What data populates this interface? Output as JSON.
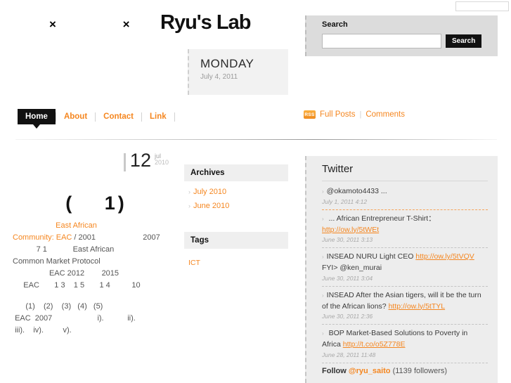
{
  "site": {
    "title": "Ryu's Lab",
    "header_glyphs": "× ×"
  },
  "top_input": {
    "value": "",
    "placeholder": ""
  },
  "date_ticket": {
    "day_of_week": "MONDAY",
    "full_date": "July 4, 2011"
  },
  "search": {
    "label": "Search",
    "input_value": "",
    "placeholder": "",
    "button_label": "Search"
  },
  "nav": {
    "items": [
      {
        "label": "Home",
        "active": true
      },
      {
        "label": "About",
        "active": false
      },
      {
        "label": "Contact",
        "active": false
      },
      {
        "label": "Link",
        "active": false
      }
    ]
  },
  "feeds": {
    "rss_badge": "RSS",
    "full_posts": "Full Posts",
    "separator": "|",
    "comments": "Comments"
  },
  "article": {
    "day": "12",
    "month": "jul",
    "year": "2010",
    "title": "(　 1)",
    "lines": [
      {
        "segments": [
          {
            "text": "                    ",
            "accent": false
          },
          {
            "text": "East African",
            "accent": true
          }
        ]
      },
      {
        "segments": [
          {
            "text": "Community: EAC",
            "accent": true
          },
          {
            "text": " / 2001                      2007",
            "accent": false
          }
        ]
      },
      {
        "segments": [
          {
            "text": "           7 1            East African",
            "accent": false
          }
        ]
      },
      {
        "segments": [
          {
            "text": "Common Market Protocol",
            "accent": false
          }
        ]
      },
      {
        "segments": [
          {
            "text": "                 EAC 2012        2015",
            "accent": false
          }
        ]
      },
      {
        "segments": [
          {
            "text": "     EAC       1 3    1 5       1 4          10",
            "accent": false
          }
        ]
      },
      {
        "gap": true
      },
      {
        "segments": [
          {
            "text": "      (1)    (2)    (3)   (4)   (5)",
            "accent": false
          }
        ]
      },
      {
        "segments": [
          {
            "text": " EAC  2007                     i).           ii).",
            "accent": false
          }
        ]
      },
      {
        "segments": [
          {
            "text": " iii).    iv).         v).",
            "accent": false
          }
        ]
      }
    ]
  },
  "archives": {
    "heading": "Archives",
    "items": [
      "July 2010",
      "June 2010"
    ]
  },
  "tags": {
    "heading": "Tags",
    "items": [
      "ICT"
    ]
  },
  "twitter": {
    "heading": "Twitter",
    "tweets": [
      {
        "text": "@okamoto4433                ...",
        "link": "",
        "time": "July 1, 2011 4:12",
        "sep_accent": true
      },
      {
        "text": "              ... African Entrepreneur T-Shirt：",
        "link": "http://ow.ly/5tWEt",
        "time": "June 30, 2011 3:13",
        "sep_accent": false
      },
      {
        "text": "INSEAD            NURU Light       CEO",
        "link": "http://ow.ly/5tVQV",
        "link_suffix": " FYI> @ken_murai",
        "time": "June 30, 2011 3:04",
        "sep_accent": false
      },
      {
        "text": "INSEAD                    After the Asian tigers, will it be the turn of the African lions?",
        "link": "http://ow.ly/5tTYL",
        "time": "June 30, 2011 2:36",
        "sep_accent": false
      },
      {
        "text": "        BOP              Market-Based Solutions to Poverty in Africa",
        "link": "http://t.co/o5Z778E",
        "time": "June 28, 2011 11:48",
        "sep_accent": false
      }
    ],
    "follow_prefix": "Follow ",
    "follow_handle": "@ryu_saito",
    "follow_count": " (1139 followers)"
  },
  "colors": {
    "accent": "#f5861f",
    "panel_bg": "#ededed",
    "search_bg": "#dcdcdc",
    "ticket_bg": "#f2f2f2",
    "dark": "#111111"
  }
}
